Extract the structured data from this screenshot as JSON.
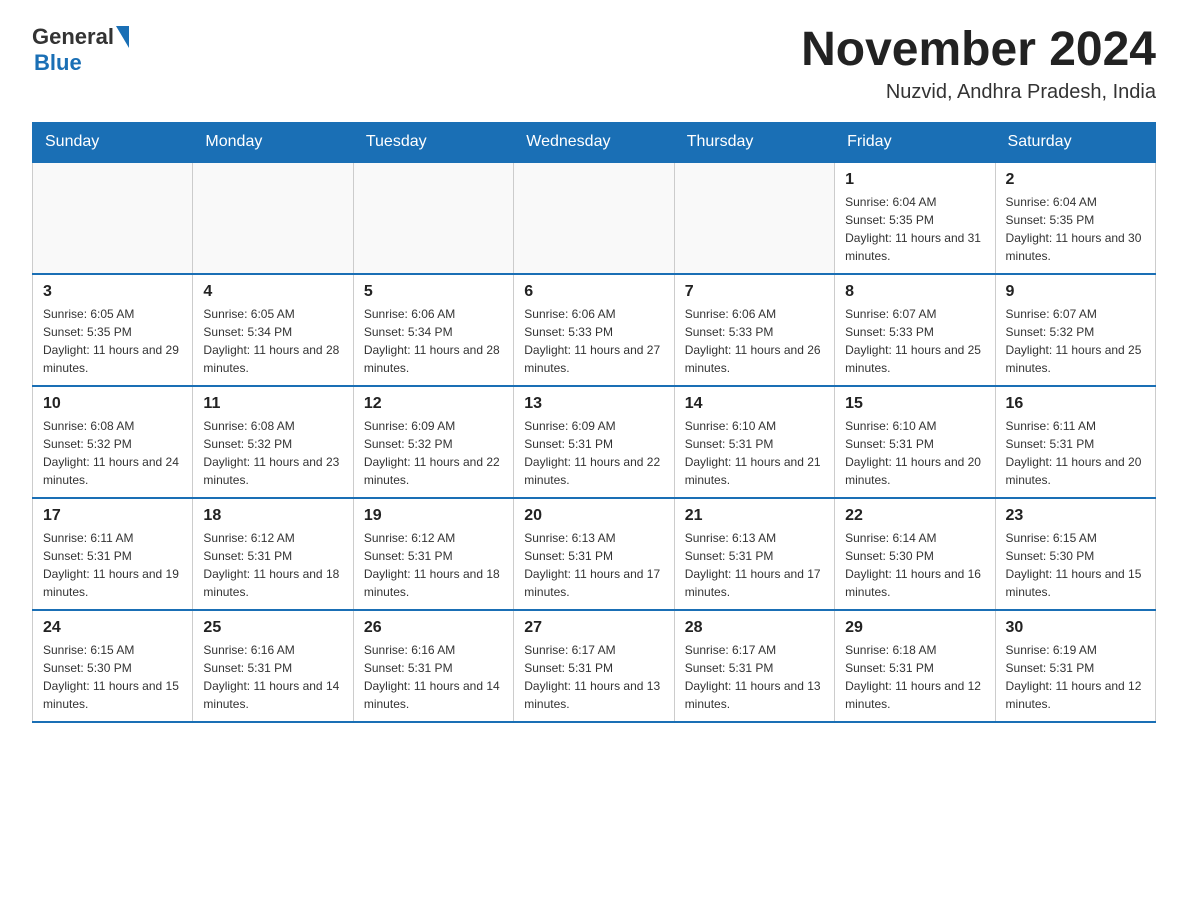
{
  "header": {
    "logo": {
      "general": "General",
      "triangle": "▶",
      "blue": "Blue"
    },
    "title": "November 2024",
    "subtitle": "Nuzvid, Andhra Pradesh, India"
  },
  "weekdays": [
    "Sunday",
    "Monday",
    "Tuesday",
    "Wednesday",
    "Thursday",
    "Friday",
    "Saturday"
  ],
  "weeks": [
    [
      {
        "day": "",
        "info": ""
      },
      {
        "day": "",
        "info": ""
      },
      {
        "day": "",
        "info": ""
      },
      {
        "day": "",
        "info": ""
      },
      {
        "day": "",
        "info": ""
      },
      {
        "day": "1",
        "info": "Sunrise: 6:04 AM\nSunset: 5:35 PM\nDaylight: 11 hours and 31 minutes."
      },
      {
        "day": "2",
        "info": "Sunrise: 6:04 AM\nSunset: 5:35 PM\nDaylight: 11 hours and 30 minutes."
      }
    ],
    [
      {
        "day": "3",
        "info": "Sunrise: 6:05 AM\nSunset: 5:35 PM\nDaylight: 11 hours and 29 minutes."
      },
      {
        "day": "4",
        "info": "Sunrise: 6:05 AM\nSunset: 5:34 PM\nDaylight: 11 hours and 28 minutes."
      },
      {
        "day": "5",
        "info": "Sunrise: 6:06 AM\nSunset: 5:34 PM\nDaylight: 11 hours and 28 minutes."
      },
      {
        "day": "6",
        "info": "Sunrise: 6:06 AM\nSunset: 5:33 PM\nDaylight: 11 hours and 27 minutes."
      },
      {
        "day": "7",
        "info": "Sunrise: 6:06 AM\nSunset: 5:33 PM\nDaylight: 11 hours and 26 minutes."
      },
      {
        "day": "8",
        "info": "Sunrise: 6:07 AM\nSunset: 5:33 PM\nDaylight: 11 hours and 25 minutes."
      },
      {
        "day": "9",
        "info": "Sunrise: 6:07 AM\nSunset: 5:32 PM\nDaylight: 11 hours and 25 minutes."
      }
    ],
    [
      {
        "day": "10",
        "info": "Sunrise: 6:08 AM\nSunset: 5:32 PM\nDaylight: 11 hours and 24 minutes."
      },
      {
        "day": "11",
        "info": "Sunrise: 6:08 AM\nSunset: 5:32 PM\nDaylight: 11 hours and 23 minutes."
      },
      {
        "day": "12",
        "info": "Sunrise: 6:09 AM\nSunset: 5:32 PM\nDaylight: 11 hours and 22 minutes."
      },
      {
        "day": "13",
        "info": "Sunrise: 6:09 AM\nSunset: 5:31 PM\nDaylight: 11 hours and 22 minutes."
      },
      {
        "day": "14",
        "info": "Sunrise: 6:10 AM\nSunset: 5:31 PM\nDaylight: 11 hours and 21 minutes."
      },
      {
        "day": "15",
        "info": "Sunrise: 6:10 AM\nSunset: 5:31 PM\nDaylight: 11 hours and 20 minutes."
      },
      {
        "day": "16",
        "info": "Sunrise: 6:11 AM\nSunset: 5:31 PM\nDaylight: 11 hours and 20 minutes."
      }
    ],
    [
      {
        "day": "17",
        "info": "Sunrise: 6:11 AM\nSunset: 5:31 PM\nDaylight: 11 hours and 19 minutes."
      },
      {
        "day": "18",
        "info": "Sunrise: 6:12 AM\nSunset: 5:31 PM\nDaylight: 11 hours and 18 minutes."
      },
      {
        "day": "19",
        "info": "Sunrise: 6:12 AM\nSunset: 5:31 PM\nDaylight: 11 hours and 18 minutes."
      },
      {
        "day": "20",
        "info": "Sunrise: 6:13 AM\nSunset: 5:31 PM\nDaylight: 11 hours and 17 minutes."
      },
      {
        "day": "21",
        "info": "Sunrise: 6:13 AM\nSunset: 5:31 PM\nDaylight: 11 hours and 17 minutes."
      },
      {
        "day": "22",
        "info": "Sunrise: 6:14 AM\nSunset: 5:30 PM\nDaylight: 11 hours and 16 minutes."
      },
      {
        "day": "23",
        "info": "Sunrise: 6:15 AM\nSunset: 5:30 PM\nDaylight: 11 hours and 15 minutes."
      }
    ],
    [
      {
        "day": "24",
        "info": "Sunrise: 6:15 AM\nSunset: 5:30 PM\nDaylight: 11 hours and 15 minutes."
      },
      {
        "day": "25",
        "info": "Sunrise: 6:16 AM\nSunset: 5:31 PM\nDaylight: 11 hours and 14 minutes."
      },
      {
        "day": "26",
        "info": "Sunrise: 6:16 AM\nSunset: 5:31 PM\nDaylight: 11 hours and 14 minutes."
      },
      {
        "day": "27",
        "info": "Sunrise: 6:17 AM\nSunset: 5:31 PM\nDaylight: 11 hours and 13 minutes."
      },
      {
        "day": "28",
        "info": "Sunrise: 6:17 AM\nSunset: 5:31 PM\nDaylight: 11 hours and 13 minutes."
      },
      {
        "day": "29",
        "info": "Sunrise: 6:18 AM\nSunset: 5:31 PM\nDaylight: 11 hours and 12 minutes."
      },
      {
        "day": "30",
        "info": "Sunrise: 6:19 AM\nSunset: 5:31 PM\nDaylight: 11 hours and 12 minutes."
      }
    ]
  ]
}
